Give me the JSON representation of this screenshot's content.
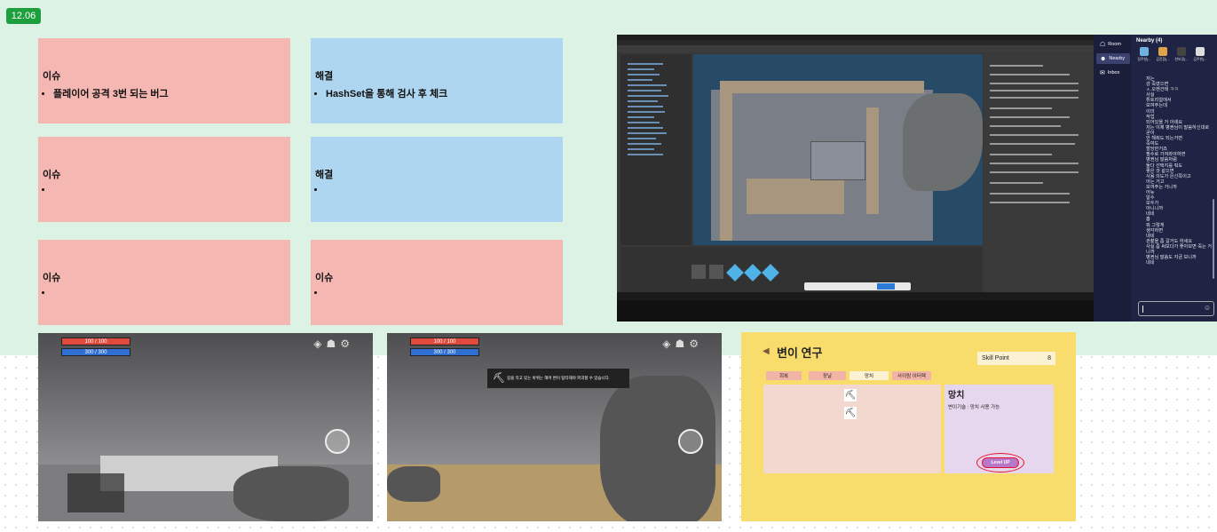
{
  "date_badge": "12.06",
  "notes": [
    {
      "title": "이슈",
      "bullet": "플레이어 공격 3번 되는 버그"
    },
    {
      "title": "해결",
      "bullet": "HashSet을 통해 검사 후 체크"
    },
    {
      "title": "이슈",
      "bullet": ""
    },
    {
      "title": "해결",
      "bullet": ""
    },
    {
      "title": "이슈",
      "bullet": ""
    },
    {
      "title": "이슈",
      "bullet": ""
    }
  ],
  "chat": {
    "nav": [
      "Room",
      "Nearby",
      "Inbox"
    ],
    "header": "Nearby (4)",
    "avatars": [
      "정주현(...",
      "김진환(...",
      "한보경(...",
      "김주현(..."
    ],
    "messages": [
      "저는",
      "걍 죽였으면",
      "ㅅ.오캔건테 ㅋㅋ",
      "사실",
      "튜토리얼에서",
      "보여주는데",
      "이미",
      "작업",
      "되어있을 거 아녜요",
      "저는 이제 병권님이 말씀하신대로",
      "굳이",
      "안 해줘도 되는거면",
      "죽여도",
      "할당한거죠",
      "필수로 가져와야하면",
      "병권님 말씀처럼",
      "둘다 선택지를 줘도",
      "좋은 것 같으면",
      "사용 의도가 은신쪽이고",
      "아는 거고",
      "보여주는 거니까",
      "어뉴",
      "알수",
      "모두가",
      "아니니까",
      "네네",
      "흠",
      "뭐 그렇게",
      "생각하면",
      "네네",
      "관찰을 좀 갈거도 하세요",
      "사실 좀 써보다가 좋아보면 죽는 거니까",
      "병권님 말씀도 지금 보니까",
      "네네"
    ]
  },
  "game1": {
    "hp": "100 / 100",
    "mp": "300 / 300"
  },
  "game2": {
    "hp": "100 / 100",
    "mp": "300 / 300",
    "tooltip": "길을 막고 있는 바위는 해머 변이 탐타해야 파괴할 수 있습니다."
  },
  "research": {
    "title": "변이 연구",
    "skill_point_label": "Skill Point",
    "skill_point_value": "8",
    "tabs": [
      "회복",
      "장날",
      "망치",
      "사이링 이터렉"
    ],
    "detail_title": "망치",
    "detail_desc": "변이기술 : 망치 사용 가능",
    "level_up": "Level UP"
  }
}
